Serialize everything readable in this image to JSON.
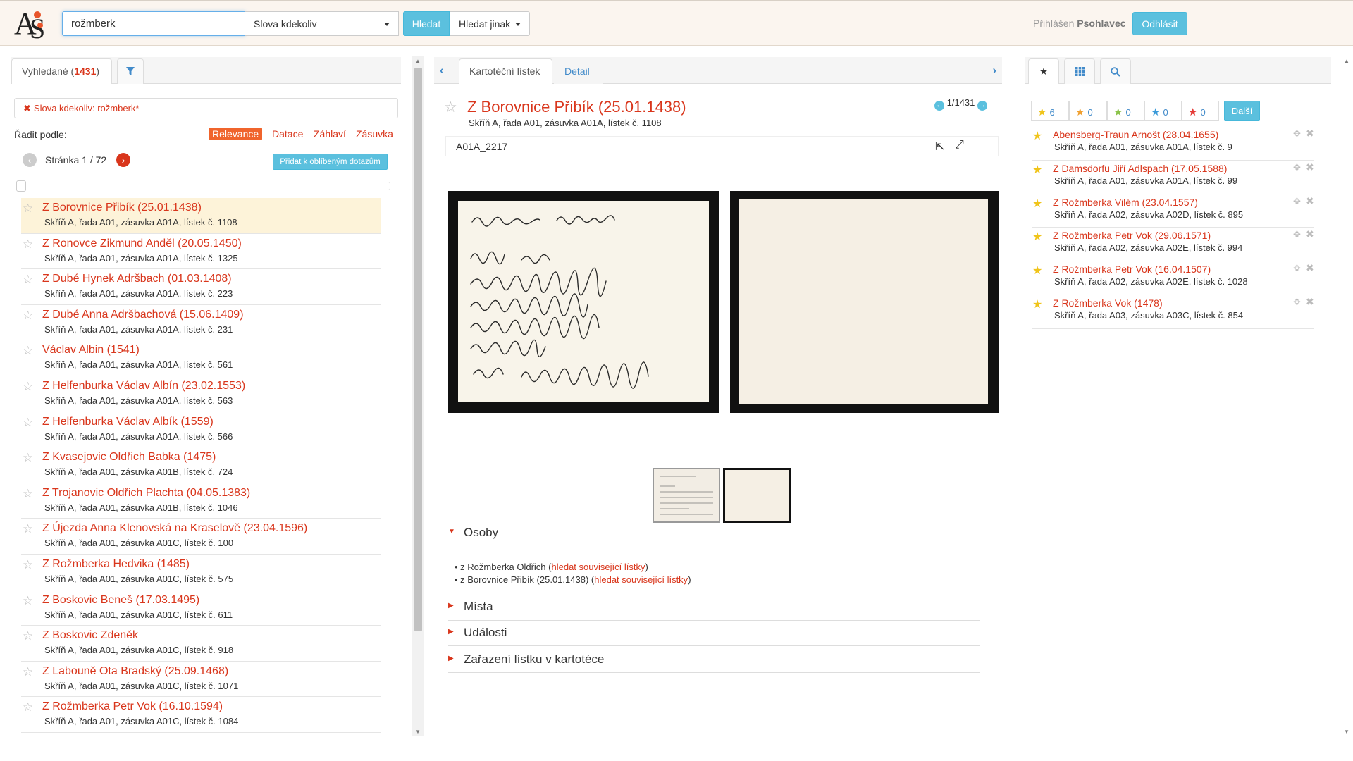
{
  "header": {
    "logo": "AS",
    "search_value": "rožmberk",
    "search_mode": "Slova kdekoliv",
    "search_button": "Hledat",
    "search_other": "Hledat jinak",
    "login_prefix": "Přihlášen",
    "login_user": "Psohlavec",
    "logout_button": "Odhlásit"
  },
  "left": {
    "tab_found_label": "Vyhledané",
    "tab_found_count": "1431",
    "filter_chip": "Slova kdekoliv: rožmberk*",
    "sort_label": "Řadit podle:",
    "sort_options": [
      "Relevance",
      "Datace",
      "Záhlaví",
      "Zásuvka"
    ],
    "page_label": "Stránka 1 / 72",
    "fav_query_button": "Přidat k oblíbeným dotazům",
    "results": [
      {
        "title": "Z Borovnice Přibík (25.01.1438)",
        "sub": "Skříň A, řada A01, zásuvka A01A, lístek č. 1108"
      },
      {
        "title": "Z Ronovce Zikmund Anděl (20.05.1450)",
        "sub": "Skříň A, řada A01, zásuvka A01A, lístek č. 1325"
      },
      {
        "title": "Z Dubé Hynek Adršbach (01.03.1408)",
        "sub": "Skříň A, řada A01, zásuvka A01A, lístek č. 223"
      },
      {
        "title": "Z Dubé Anna Adršbachová (15.06.1409)",
        "sub": "Skříň A, řada A01, zásuvka A01A, lístek č. 231"
      },
      {
        "title": "Václav Albin (1541)",
        "sub": "Skříň A, řada A01, zásuvka A01A, lístek č. 561"
      },
      {
        "title": "Z Helfenburka Václav Albín (23.02.1553)",
        "sub": "Skříň A, řada A01, zásuvka A01A, lístek č. 563"
      },
      {
        "title": "Z Helfenburka Václav Albík (1559)",
        "sub": "Skříň A, řada A01, zásuvka A01A, lístek č. 566"
      },
      {
        "title": "Z Kvasejovic Oldřich Babka (1475)",
        "sub": "Skříň A, řada A01, zásuvka A01B, lístek č. 724"
      },
      {
        "title": "Z Trojanovic Oldřich Plachta (04.05.1383)",
        "sub": "Skříň A, řada A01, zásuvka A01B, lístek č. 1046"
      },
      {
        "title": "Z Újezda Anna Klenovská na Kraselově (23.04.1596)",
        "sub": "Skříň A, řada A01, zásuvka A01C, lístek č. 100"
      },
      {
        "title": "Z Rožmberka Hedvika (1485)",
        "sub": "Skříň A, řada A01, zásuvka A01C, lístek č. 575"
      },
      {
        "title": "Z Boskovic Beneš (17.03.1495)",
        "sub": "Skříň A, řada A01, zásuvka A01C, lístek č. 611"
      },
      {
        "title": "Z Boskovic Zdeněk",
        "sub": "Skříň A, řada A01, zásuvka A01C, lístek č. 918"
      },
      {
        "title": "Z Labouně Ota Bradský (25.09.1468)",
        "sub": "Skříň A, řada A01, zásuvka A01C, lístek č. 1071"
      },
      {
        "title": "Z Rožmberka Petr Vok (16.10.1594)",
        "sub": "Skříň A, řada A01, zásuvka A01C, lístek č. 1084"
      }
    ]
  },
  "middle": {
    "tab_card": "Kartotéční lístek",
    "tab_detail": "Detail",
    "record_title": "Z Borovnice Přibík (25.01.1438)",
    "record_sub": "Skříň A, řada A01, zásuvka A01A, lístek č. 1108",
    "record_nav": "1/1431",
    "code": "A01A_2217",
    "section_osoby": "Osoby",
    "persons": [
      {
        "name": "z Rožmberka Oldřich",
        "link": "hledat související lístky"
      },
      {
        "name": "z Borovnice Přibík (25.01.1438)",
        "link": "hledat související lístky"
      }
    ],
    "section_mista": "Místa",
    "section_udalosti": "Události",
    "section_zarazeni": "Zařazení lístku v kartotéce"
  },
  "right": {
    "star_counts": [
      {
        "color": "#f0c419",
        "count": "6"
      },
      {
        "color": "#f0a030",
        "count": "0"
      },
      {
        "color": "#8bc34a",
        "count": "0"
      },
      {
        "color": "#3a9ad9",
        "count": "0"
      },
      {
        "color": "#e53935",
        "count": "0"
      }
    ],
    "more_button": "Další",
    "favorites": [
      {
        "title": "Abensberg-Traun Arnošt (28.04.1655)",
        "sub": "Skříň A, řada A01, zásuvka A01A, lístek č. 9"
      },
      {
        "title": "Z Damsdorfu Jiří Adlspach (17.05.1588)",
        "sub": "Skříň A, řada A01, zásuvka A01A, lístek č. 99"
      },
      {
        "title": "Z Rožmberka Vilém (23.04.1557)",
        "sub": "Skříň A, řada A02, zásuvka A02D, lístek č. 895"
      },
      {
        "title": "Z Rožmberka Petr Vok (29.06.1571)",
        "sub": "Skříň A, řada A02, zásuvka A02E, lístek č. 994"
      },
      {
        "title": "Z Rožmberka Petr Vok (16.04.1507)",
        "sub": "Skříň A, řada A02, zásuvka A02E, lístek č. 1028"
      },
      {
        "title": "Z Rožmberka Vok (1478)",
        "sub": "Skříň A, řada A03, zásuvka A03C, lístek č. 854"
      }
    ]
  }
}
